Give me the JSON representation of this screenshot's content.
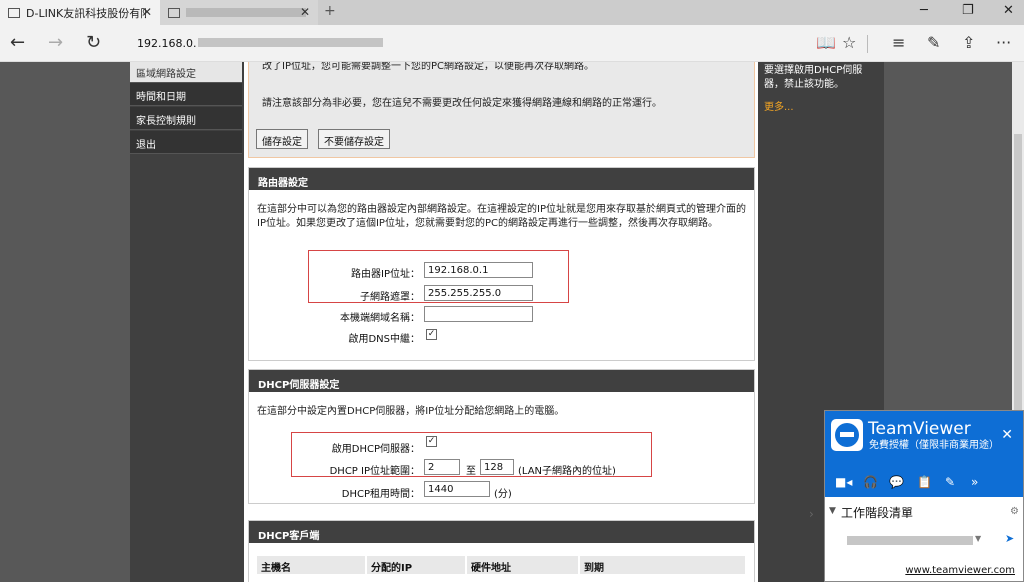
{
  "browser": {
    "tabs": [
      {
        "title": "D-LINK友訊科技股份有限",
        "active": true
      },
      {
        "title": "",
        "active": false
      }
    ],
    "new_tab": "+",
    "window_controls": {
      "minimize": "─",
      "maximize": "❐",
      "close": "✕"
    },
    "nav": {
      "back": "←",
      "forward": "→",
      "refresh": "↻"
    },
    "url": "192.168.0.",
    "tools": {
      "reading": "📖",
      "favorite": "☆",
      "hub": "≡",
      "note": "✎",
      "share": "⇪",
      "more": "···"
    }
  },
  "left_menu": {
    "items": [
      {
        "label": "區域網路設定",
        "selected": true
      },
      {
        "label": "時間和日期",
        "selected": false
      },
      {
        "label": "家長控制規則",
        "selected": false
      },
      {
        "label": "退出",
        "selected": false
      }
    ]
  },
  "warning_box": {
    "line1": "改了IP位址，您可能需要調整一下您的PC網路設定，以便能再次存取網路。",
    "line2": "請注意該部分為非必要，您在這兒不需要更改任何設定來獲得網路連線和網路的正常運行。",
    "save_label": "儲存設定",
    "nosave_label": "不要儲存設定"
  },
  "router_settings": {
    "title": "路由器設定",
    "description": "在這部分中可以為您的路由器設定內部網路設定。在這裡設定的IP位址就是您用來存取基於網頁式的管理介面的IP位址。如果您更改了這個IP位址，您就需要對您的PC的網路設定再進行一些調整，然後再次存取網路。",
    "ip_label": "路由器IP位址：",
    "ip_value": "192.168.0.1",
    "mask_label": "子網路遮罩：",
    "mask_value": "255.255.255.0",
    "domain_label": "本機端網域名稱：",
    "domain_value": "",
    "dns_label": "啟用DNS中繼：",
    "dns_checked": "✓"
  },
  "dhcp_settings": {
    "title": "DHCP伺服器設定",
    "description": "在這部分中設定內置DHCP伺服器，將IP位址分配給您網路上的電腦。",
    "enable_label": "啟用DHCP伺服器：",
    "enable_checked": "✓",
    "range_label": "DHCP IP位址範圍：",
    "range_start": "2",
    "range_to": "至",
    "range_end": "128",
    "range_note": "(LAN子網路內的位址)",
    "lease_label": "DHCP租用時間：",
    "lease_value": "1440",
    "lease_unit": "(分)"
  },
  "dhcp_clients": {
    "title": "DHCP客戶端",
    "columns": [
      "主機名",
      "分配的IP",
      "硬件地址",
      "到期"
    ]
  },
  "right_hint": {
    "text": "要選擇啟用DHCP伺服器，禁止該功能。",
    "more": "更多..."
  },
  "teamviewer": {
    "name": "TeamViewer",
    "subtitle": "免費授權（僅限非商業用途）",
    "close": "✕",
    "tools": [
      "■◂",
      "🎧",
      "💬",
      "📋",
      "✎",
      "»"
    ],
    "session_list": "工作階段清單",
    "link": "www.teamviewer.com"
  }
}
